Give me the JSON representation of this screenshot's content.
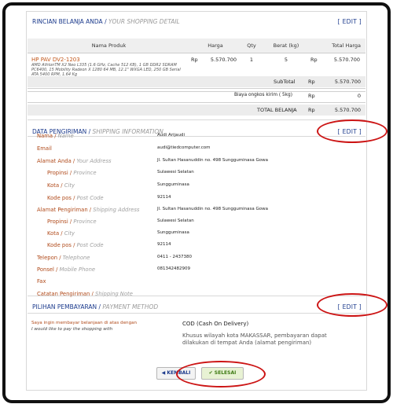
{
  "summary": {
    "title": "RINCIAN BELANJA ANDA",
    "title_sep": " / ",
    "title_en": "YOUR SHOPPING DETAIL",
    "edit_label": "[ EDIT ]"
  },
  "cart": {
    "headers": [
      "Nama Produk",
      "Harga",
      "Qty",
      "Berat (kg)",
      "Total Harga"
    ],
    "item": {
      "name": "HP PAV DV2-1203",
      "desc": "AMD AthlonTM X2 Neo L335 (1.6 GHz, Cache 512 KB), 1 GB DDR2 SDRAM PC6400, 15 Mobility Radeon X 1280 64 MB, 12.1\" WXGA LED, 250 GB Serial ATA 5400 RPM, 1.64 Kg",
      "currency": "Rp",
      "price": "5.570.700",
      "qty": "1",
      "weight": "5",
      "total_currency": "Rp",
      "total": "5.570.700"
    },
    "subtotal_label": "SubTotal",
    "subtotal_currency": "Rp",
    "subtotal": "5.570.700",
    "shipping_label": "Biaya ongkos kirim ( 5kg)",
    "shipping_currency": "Rp",
    "shipping": "0",
    "grand_label": "TOTAL BELANJA",
    "grand_currency": "Rp",
    "grand_total": "5.570.700"
  },
  "shipping_info": {
    "title": "DATA PENGIRIMAN",
    "title_sep": " / ",
    "title_en": "SHIPPING INFORMATION",
    "edit_label": "[ EDIT ]",
    "fields": [
      {
        "label": "Nama",
        "label_en": "Name",
        "value": "Audi Arijaudi"
      },
      {
        "label": "Email",
        "label_en": "",
        "value": "audi@tiedcomputer.com"
      },
      {
        "label": "Alamat Anda",
        "label_en": "Your Address",
        "value": "Jl. Sultan Hasanuddin no. 498 Sungguminasa Gowa"
      },
      {
        "label": "Propinsi",
        "label_en": "Province",
        "value": "Sulawesi Selatan"
      },
      {
        "label": "Kota",
        "label_en": "City",
        "value": "Sungguminasa"
      },
      {
        "label": "Kode pos",
        "label_en": "Post Code",
        "value": "92114"
      },
      {
        "label": "Alamat Pengiriman",
        "label_en": "Shipping Address",
        "value": "Jl. Sultan Hasanuddin no. 498 Sungguminasa Gowa"
      },
      {
        "label": "Propinsi",
        "label_en": "Province",
        "value": "Sulawesi Selatan"
      },
      {
        "label": "Kota",
        "label_en": "City",
        "value": "Sungguminasa"
      },
      {
        "label": "Kode pos",
        "label_en": "Post Code",
        "value": "92114"
      },
      {
        "label": "Telepon",
        "label_en": "Telephone",
        "value": "0411 - 2437380"
      },
      {
        "label": "Ponsel",
        "label_en": "Mobile Phone",
        "value": "081342482909"
      },
      {
        "label": "Fax",
        "label_en": "",
        "value": ""
      },
      {
        "label": "Catatan Pengiriman",
        "label_en": "Shipping Note",
        "value": ""
      }
    ]
  },
  "payment": {
    "title": "PILIHAN PEMBAYARAN",
    "title_sep": " / ",
    "title_en": "PAYMENT METHOD",
    "edit_label": "[ EDIT ]",
    "prompt_id": "Saya ingin membayar belanjaan di atas dengan",
    "prompt_en": "I would like to pay the shopping with",
    "method": "COD (Cash On Delivery)",
    "note": "Khusus wilayah kota MAKASSAR, pembayaran dapat dilakukan di tempat Anda (alamat pengiriman)"
  },
  "buttons": {
    "back_icon": "◀",
    "back_label": "KEMBALI",
    "done_icon": "✔",
    "done_label": "SELESAI"
  },
  "colors": {
    "accent_blue": "#1b3a8c",
    "label_orange": "#b04a1a",
    "annotation_red": "#cc1414"
  }
}
